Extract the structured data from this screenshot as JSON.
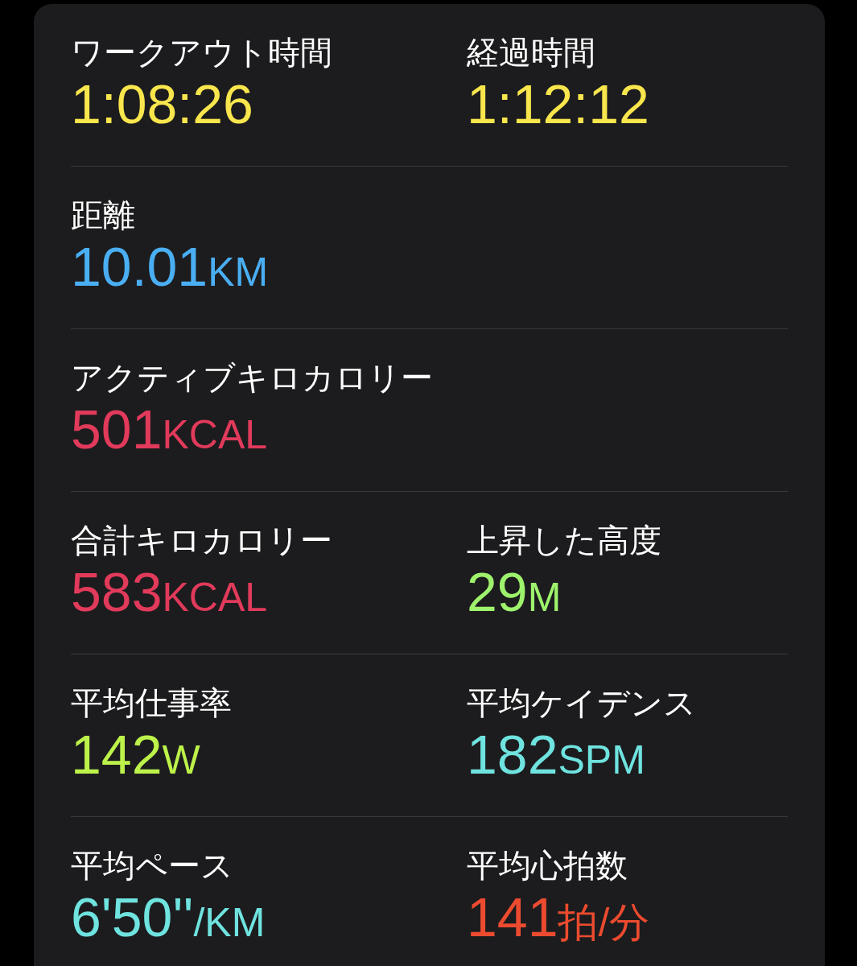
{
  "rows": [
    {
      "metrics": [
        {
          "label": "ワークアウト時間",
          "value": "1:08:26",
          "color": "#f9e64d"
        },
        {
          "label": "経過時間",
          "value": "1:12:12",
          "color": "#f9e64d"
        }
      ]
    },
    {
      "metrics": [
        {
          "label": "距離",
          "value": "10.01",
          "unit": "KM",
          "color": "#4aaef2"
        }
      ]
    },
    {
      "metrics": [
        {
          "label": "アクティブキロカロリー",
          "value": "501",
          "unit": "KCAL",
          "color": "#e13a5b"
        }
      ]
    },
    {
      "metrics": [
        {
          "label": "合計キロカロリー",
          "value": "583",
          "unit": "KCAL",
          "color": "#e13a5b"
        },
        {
          "label": "上昇した高度",
          "value": "29",
          "unit": "M",
          "color": "#9ef26c"
        }
      ]
    },
    {
      "metrics": [
        {
          "label": "平均仕事率",
          "value": "142",
          "unit": "W",
          "color": "#bdf24a"
        },
        {
          "label": "平均ケイデンス",
          "value": "182",
          "unit": "SPM",
          "color": "#6fe3df"
        }
      ]
    },
    {
      "metrics": [
        {
          "label": "平均ペース",
          "value": "6'50''",
          "unit": "/KM",
          "color": "#6fe3df"
        },
        {
          "label": "平均心拍数",
          "value": "141",
          "unit": "拍/分",
          "color": "#ec4b2f"
        }
      ]
    }
  ]
}
